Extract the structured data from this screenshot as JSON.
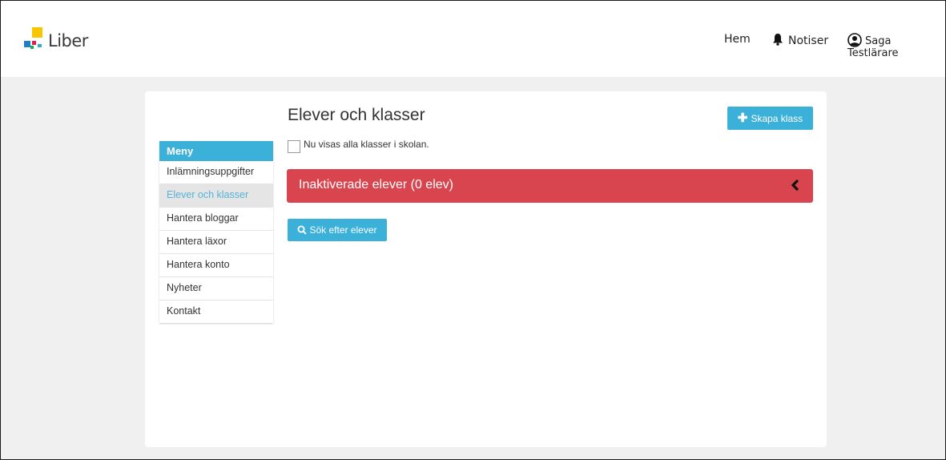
{
  "header": {
    "brand": "Liber",
    "nav": {
      "home": "Hem",
      "notifications": "Notiser",
      "user": "Saga Testlärare"
    }
  },
  "sidebar": {
    "heading": "Meny",
    "items": [
      {
        "label": "Inlämningsuppgifter"
      },
      {
        "label": "Elever och klasser"
      },
      {
        "label": "Hantera bloggar"
      },
      {
        "label": "Hantera läxor"
      },
      {
        "label": "Hantera konto"
      },
      {
        "label": "Nyheter"
      },
      {
        "label": "Kontakt"
      }
    ],
    "active_index": 1
  },
  "main": {
    "title": "Elever och klasser",
    "create_button": "Skapa klass",
    "checkbox_label": "Nu visas alla klasser i skolan.",
    "checkbox_checked": false,
    "inactive_panel": "Inaktiverade elever (0 elev)",
    "search_button": "Sök efter elever"
  },
  "colors": {
    "accent": "#3bb1da",
    "danger": "#d9454f",
    "background": "#f0f0f0"
  },
  "icons": [
    "liber-logo",
    "bell-icon",
    "user-circle-icon",
    "plus-icon",
    "chevron-left-icon",
    "search-icon"
  ]
}
